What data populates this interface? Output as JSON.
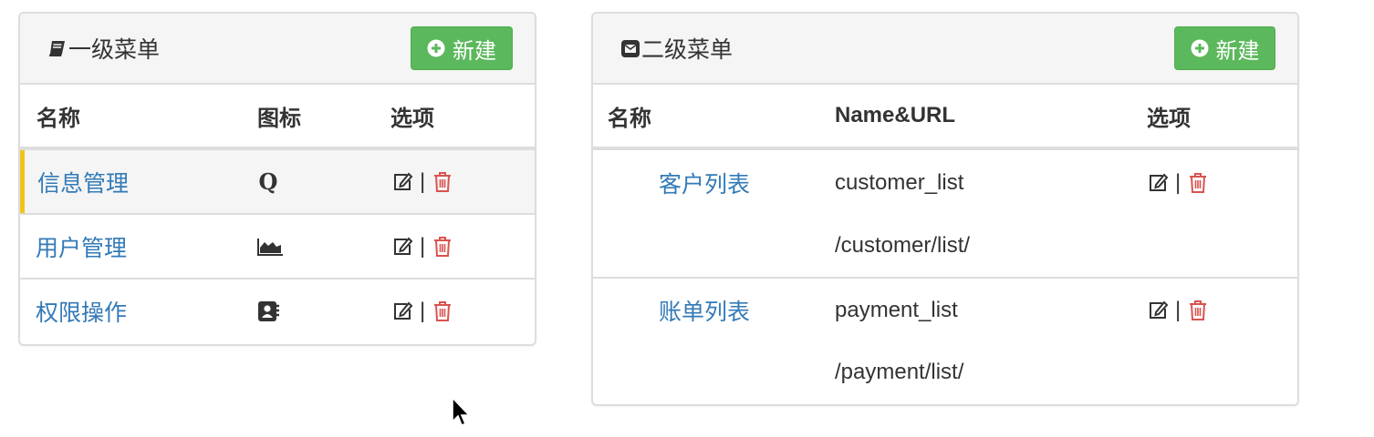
{
  "left_panel": {
    "title": "一级菜单",
    "title_icon": "book-icon",
    "new_button_label": "新建",
    "columns": [
      "名称",
      "图标",
      "选项"
    ],
    "rows": [
      {
        "name": "信息管理",
        "icon": "q-icon",
        "active": true
      },
      {
        "name": "用户管理",
        "icon": "area-chart-icon",
        "active": false
      },
      {
        "name": "权限操作",
        "icon": "address-book-icon",
        "active": false
      }
    ],
    "separator": "|"
  },
  "right_panel": {
    "title": "二级菜单",
    "title_icon": "envelope-square-icon",
    "new_button_label": "新建",
    "columns": [
      "名称",
      "Name&URL",
      "选项"
    ],
    "rows": [
      {
        "name": "客户列表",
        "url_name": "customer_list",
        "url": "/customer/list/"
      },
      {
        "name": "账单列表",
        "url_name": "payment_list",
        "url": "/payment/list/"
      }
    ],
    "separator": "|"
  },
  "colors": {
    "link": "#337ab7",
    "success_button": "#5cb85c",
    "delete_icon": "#d9534f",
    "active_marker": "#f0c419",
    "heading_bg": "#f5f5f5"
  }
}
